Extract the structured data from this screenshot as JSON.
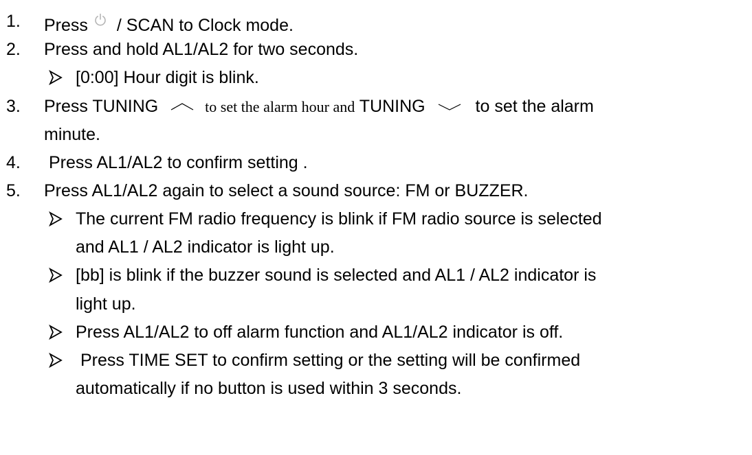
{
  "steps": [
    {
      "number": "1.",
      "text_before": "Press",
      "icon": "power-icon",
      "text_after": "/ SCAN to Clock mode."
    },
    {
      "number": "2.",
      "text": "Press and hold AL1/AL2 for two seconds.",
      "bullets": [
        {
          "text": "[0:00] Hour digit is blink."
        }
      ]
    },
    {
      "number": "3.",
      "part1": "Press TUNING",
      "icon_up": "caret-up-icon",
      "part2": "to set the alarm hour and",
      "part3": "TUNING",
      "icon_down": "caret-down-icon",
      "part4": "to set the alarm",
      "continuation": "minute."
    },
    {
      "number": "4.",
      "text": "Press AL1/AL2 to confirm setting ."
    },
    {
      "number": "5.",
      "text": "Press AL1/AL2 again to select a sound source: FM or BUZZER.",
      "bullets": [
        {
          "line1": "The current FM radio frequency is blink if FM radio source is selected",
          "line2": "and AL1 / AL2 indicator is light up."
        },
        {
          "line1": "[bb] is blink if the buzzer sound is selected and AL1 / AL2 indicator is",
          "line2": "light up."
        },
        {
          "line1": "Press AL1/AL2 to off alarm function and AL1/AL2 indicator is off."
        },
        {
          "line1": "Press TIME SET to confirm setting or the setting will be confirmed",
          "line2": "automatically if no button is used within 3 seconds."
        }
      ]
    }
  ]
}
